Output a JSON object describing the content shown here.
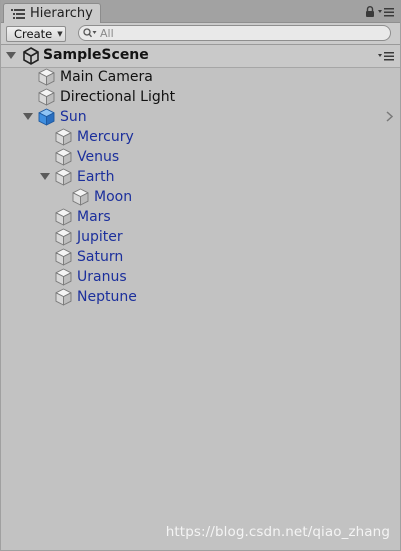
{
  "window": {
    "tab_title": "Hierarchy"
  },
  "toolbar": {
    "create_label": "Create",
    "search_placeholder": "All"
  },
  "scene": {
    "name": "SampleScene"
  },
  "tree": {
    "items": [
      {
        "label": "Main Camera",
        "depth": 1,
        "expandable": false,
        "expanded": false,
        "prefab": false,
        "icon": "gameobject-cube-icon"
      },
      {
        "label": "Directional Light",
        "depth": 1,
        "expandable": false,
        "expanded": false,
        "prefab": false,
        "icon": "gameobject-cube-icon"
      },
      {
        "label": "Sun",
        "depth": 1,
        "expandable": true,
        "expanded": true,
        "prefab": true,
        "icon": "prefab-cube-icon"
      },
      {
        "label": "Mercury",
        "depth": 2,
        "expandable": false,
        "expanded": false,
        "prefab": true,
        "icon": "gameobject-cube-icon"
      },
      {
        "label": "Venus",
        "depth": 2,
        "expandable": false,
        "expanded": false,
        "prefab": true,
        "icon": "gameobject-cube-icon"
      },
      {
        "label": "Earth",
        "depth": 2,
        "expandable": true,
        "expanded": true,
        "prefab": true,
        "icon": "gameobject-cube-icon"
      },
      {
        "label": "Moon",
        "depth": 3,
        "expandable": false,
        "expanded": false,
        "prefab": true,
        "icon": "gameobject-cube-icon"
      },
      {
        "label": "Mars",
        "depth": 2,
        "expandable": false,
        "expanded": false,
        "prefab": true,
        "icon": "gameobject-cube-icon"
      },
      {
        "label": "Jupiter",
        "depth": 2,
        "expandable": false,
        "expanded": false,
        "prefab": true,
        "icon": "gameobject-cube-icon"
      },
      {
        "label": "Saturn",
        "depth": 2,
        "expandable": false,
        "expanded": false,
        "prefab": true,
        "icon": "gameobject-cube-icon"
      },
      {
        "label": "Uranus",
        "depth": 2,
        "expandable": false,
        "expanded": false,
        "prefab": true,
        "icon": "gameobject-cube-icon"
      },
      {
        "label": "Neptune",
        "depth": 2,
        "expandable": false,
        "expanded": false,
        "prefab": true,
        "icon": "gameobject-cube-icon"
      }
    ]
  },
  "watermark": {
    "text": "https://blog.csdn.net/qiao_zhang"
  },
  "colors": {
    "panel_bg": "#c2c2c2",
    "prefab_text": "#1b2f9c",
    "normal_text": "#111111",
    "prefab_root_icon": "#3f8fe0"
  }
}
